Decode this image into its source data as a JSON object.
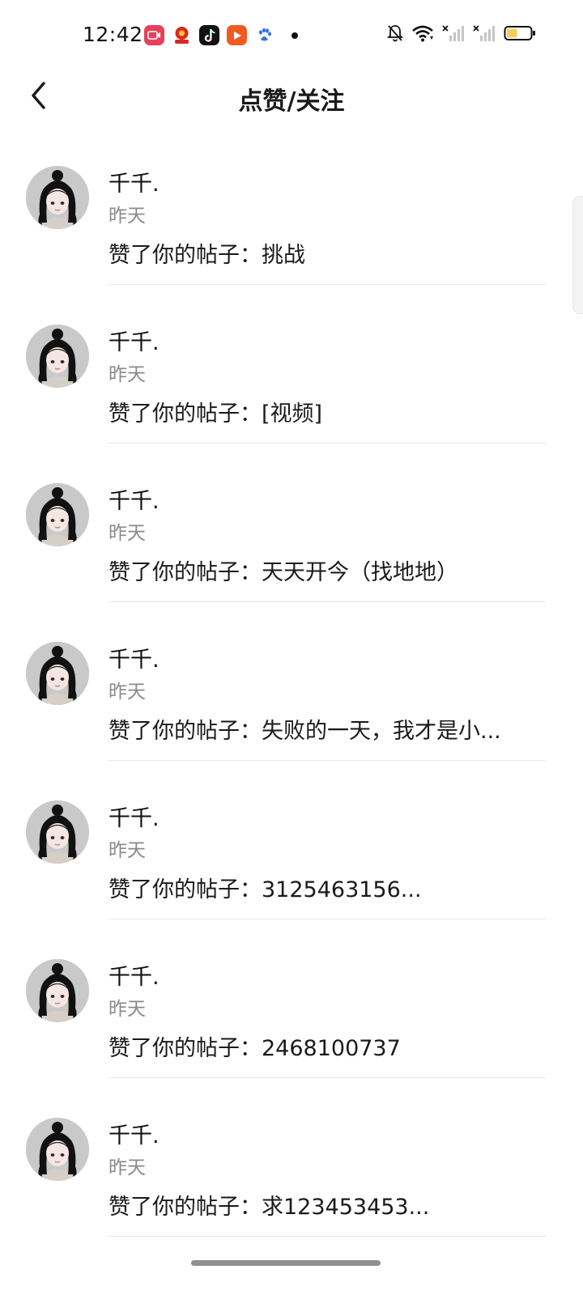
{
  "status_bar": {
    "time": "12:42",
    "app_icons": [
      "screen-recorder-icon",
      "news-app-icon",
      "tiktok-icon",
      "video-player-icon",
      "baidu-icon"
    ],
    "right_icons": [
      "mute-bell-icon",
      "wifi-icon",
      "signal-off-icon",
      "signal-off-icon",
      "battery-icon"
    ],
    "battery_level": 0.45
  },
  "header": {
    "title": "点赞/关注",
    "back_icon": "chevron-left-icon"
  },
  "notifications": [
    {
      "user": "千千.",
      "time": "昨天",
      "text": "赞了你的帖子：挑战"
    },
    {
      "user": "千千.",
      "time": "昨天",
      "text": "赞了你的帖子：[视频]"
    },
    {
      "user": "千千.",
      "time": "昨天",
      "text": "赞了你的帖子：天天开今（找地地）"
    },
    {
      "user": "千千.",
      "time": "昨天",
      "text": "赞了你的帖子：失败的一天，我才是小..."
    },
    {
      "user": "千千.",
      "time": "昨天",
      "text": "赞了你的帖子：3125463156..."
    },
    {
      "user": "千千.",
      "time": "昨天",
      "text": "赞了你的帖子：2468100737"
    },
    {
      "user": "千千.",
      "time": "昨天",
      "text": "赞了你的帖子：求123453453..."
    }
  ],
  "colors": {
    "text_primary": "#1a1a1a",
    "text_secondary": "#8a8a8a",
    "divider": "#e8e8e8",
    "battery_fill": "#f2cf5b"
  }
}
